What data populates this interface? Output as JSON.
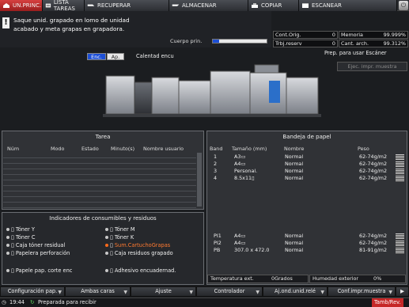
{
  "tabs": [
    {
      "label": "UN.PRINC.",
      "icon": "home-icon",
      "active": true
    },
    {
      "label": "LISTA TAREAS",
      "icon": "job-list-icon",
      "active": false
    },
    {
      "label": "RECUPERAR",
      "icon": "recall-icon",
      "active": false
    },
    {
      "label": "ALMACENAR",
      "icon": "store-icon",
      "active": false
    },
    {
      "label": "COPIAR",
      "icon": "copy-icon",
      "active": false
    },
    {
      "label": "ESCANEAR",
      "icon": "scan-icon",
      "active": false
    }
  ],
  "message": {
    "line1": "Saque unid. grapado en lomo de unidad",
    "line2": "acabado y meta grapas en grapadora.",
    "cuerpo_label": "Cuerpo prin.",
    "cuerpo_progress": 0.12
  },
  "counters": {
    "cont_orig_label": "Cont.Orig.",
    "cont_orig_value": "0",
    "memoria_label": "Memoria",
    "memoria_value": "99.999%",
    "trbj_reserv_label": "Trbj.reserv",
    "trbj_reserv_value": "0",
    "cant_arch_label": "Cant. arch.",
    "cant_arch_value": "99.312%"
  },
  "power": {
    "enc_label": "Enc.",
    "ap_label": "Ap.",
    "calentad_label": "Calentad encu"
  },
  "scanner": {
    "status": "Prep. para usar Escáner",
    "ejec_label": "Ejec. impr. muestra"
  },
  "tarea": {
    "title": "Tarea",
    "columns": [
      "Núm",
      "Modo",
      "Estado",
      "Minuto(s)",
      "Nombre usuario"
    ]
  },
  "consumibles": {
    "title": "Indicadores de consumibles y residuos",
    "items": [
      {
        "label": "Tóner Y",
        "alert": false
      },
      {
        "label": "Tóner M",
        "alert": false
      },
      {
        "label": "Tóner C",
        "alert": false
      },
      {
        "label": "Tóner K",
        "alert": false
      },
      {
        "label": "Caja tóner residual",
        "alert": false
      },
      {
        "label": "Sum.CartuchoGrapas",
        "alert": true
      },
      {
        "label": "Papelera perforación",
        "alert": false
      },
      {
        "label": "Caja residuos grapado",
        "alert": false
      },
      {
        "label": "Papele pap. corte enc",
        "alert": false
      },
      {
        "label": "Adhesivo encuadernad.",
        "alert": false
      }
    ]
  },
  "bandeja": {
    "title": "Bandeja de papel",
    "columns": [
      "Band",
      "Tamaño (mm)",
      "Nombre",
      "Peso"
    ],
    "rows": [
      {
        "band": "1",
        "size": "A3▭",
        "name": "Normal",
        "weight": "62-74g/m2"
      },
      {
        "band": "2",
        "size": "A4▭",
        "name": "Normal",
        "weight": "62-74g/m2"
      },
      {
        "band": "3",
        "size": "Personal.",
        "name": "Normal",
        "weight": "62-74g/m2"
      },
      {
        "band": "4",
        "size": "8.5x11▯",
        "name": "Normal",
        "weight": "62-74g/m2"
      }
    ],
    "rows_bottom": [
      {
        "band": "PI1",
        "size": "A4▭",
        "name": "Normal",
        "weight": "62-74g/m2"
      },
      {
        "band": "PI2",
        "size": "A4▭",
        "name": "Normal",
        "weight": "62-74g/m2"
      },
      {
        "band": "PB",
        "size": "307.0 x 472.0",
        "name": "Normal",
        "weight": "81-91g/m2"
      }
    ],
    "temp_label": "Temperatura ext.",
    "temp_value": "0Grados",
    "hum_label": "Humedad exterior",
    "hum_value": "0%"
  },
  "bottom_buttons": [
    "Configuración pap.",
    "Ambas caras",
    "Ajuste",
    "Controlador",
    "Aj.ond.unid.relé",
    "Conf.impr.muestra"
  ],
  "statusbar": {
    "time": "19:44",
    "text": "Preparada para recibir",
    "right": "Tamb/Rev."
  },
  "colors": {
    "accent_red": "#c62828",
    "alert_orange": "#ff6a1a",
    "progress_blue": "#1d4fd6"
  }
}
